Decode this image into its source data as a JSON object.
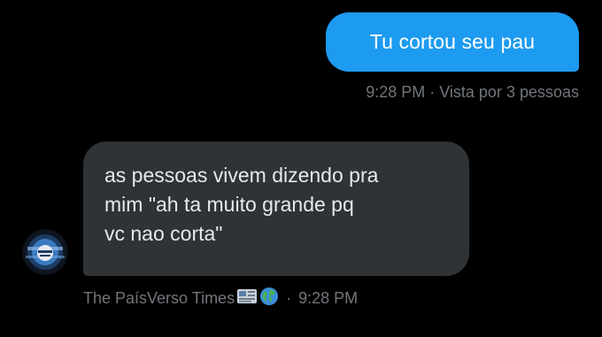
{
  "outgoing": {
    "text": "Tu cortou seu pau",
    "meta": "9:28 PM · Vista por 3 pessoas"
  },
  "incoming": {
    "lines": [
      "as pessoas vivem dizendo pra",
      "mim \"ah ta muito grande pq",
      "vc nao corta\""
    ],
    "sender": "The PaísVerso Times",
    "sender_emojis": [
      "newspaper-icon",
      "globe-icon"
    ],
    "separator": "·",
    "time": "9:28 PM"
  },
  "colors": {
    "background": "#000000",
    "outgoing_bubble": "#1d9bf0",
    "incoming_bubble": "#2f3336",
    "meta_text": "#71767b"
  }
}
